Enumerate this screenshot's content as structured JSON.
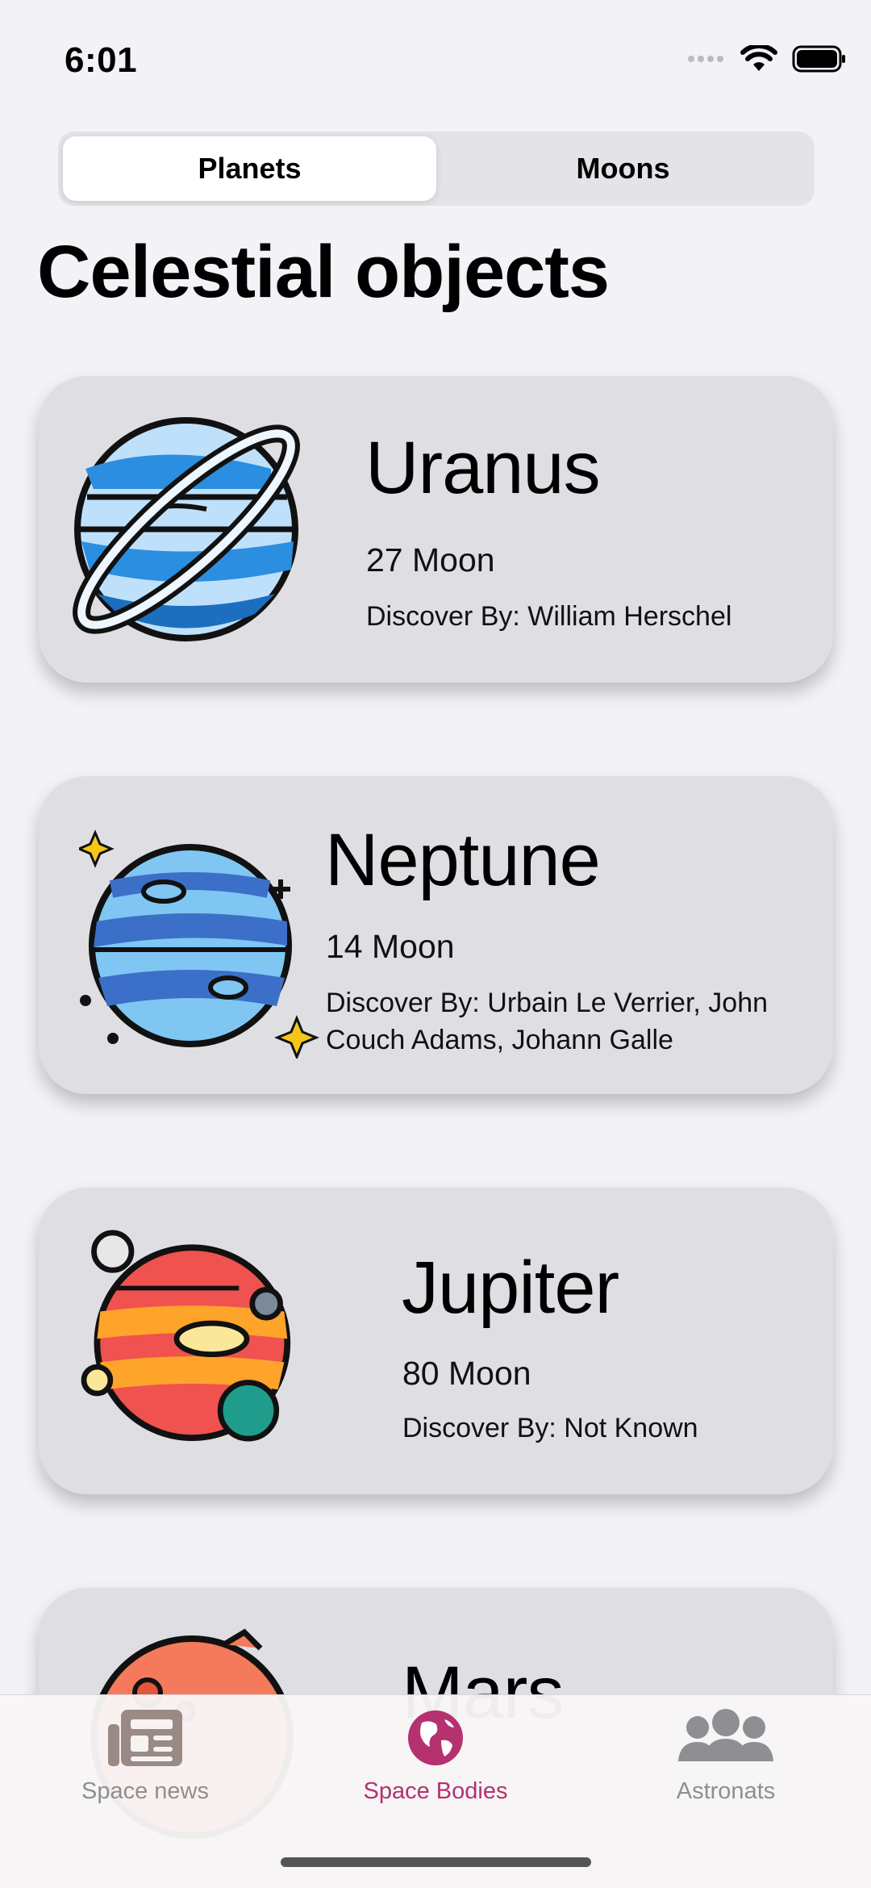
{
  "status": {
    "time": "6:01"
  },
  "segment": {
    "planets": "Planets",
    "moons": "Moons"
  },
  "title": "Celestial objects",
  "cards": [
    {
      "name": "Uranus",
      "moons": "27 Moon",
      "discovered": "Discover By: William Herschel",
      "icon": "uranus-planet-icon"
    },
    {
      "name": "Neptune",
      "moons": "14 Moon",
      "discovered": "Discover By: Urbain Le Verrier, John Couch Adams, Johann Galle",
      "icon": "neptune-planet-icon"
    },
    {
      "name": "Jupiter",
      "moons": "80 Moon",
      "discovered": "Discover By: Not Known",
      "icon": "jupiter-planet-icon"
    },
    {
      "name": "Mars",
      "icon": "mars-planet-icon"
    }
  ],
  "tabs": {
    "news": "Space news",
    "bodies": "Space Bodies",
    "astronauts": "Astronats"
  },
  "colors": {
    "accent": "#b5316f",
    "inactive": "#8e8e93"
  }
}
